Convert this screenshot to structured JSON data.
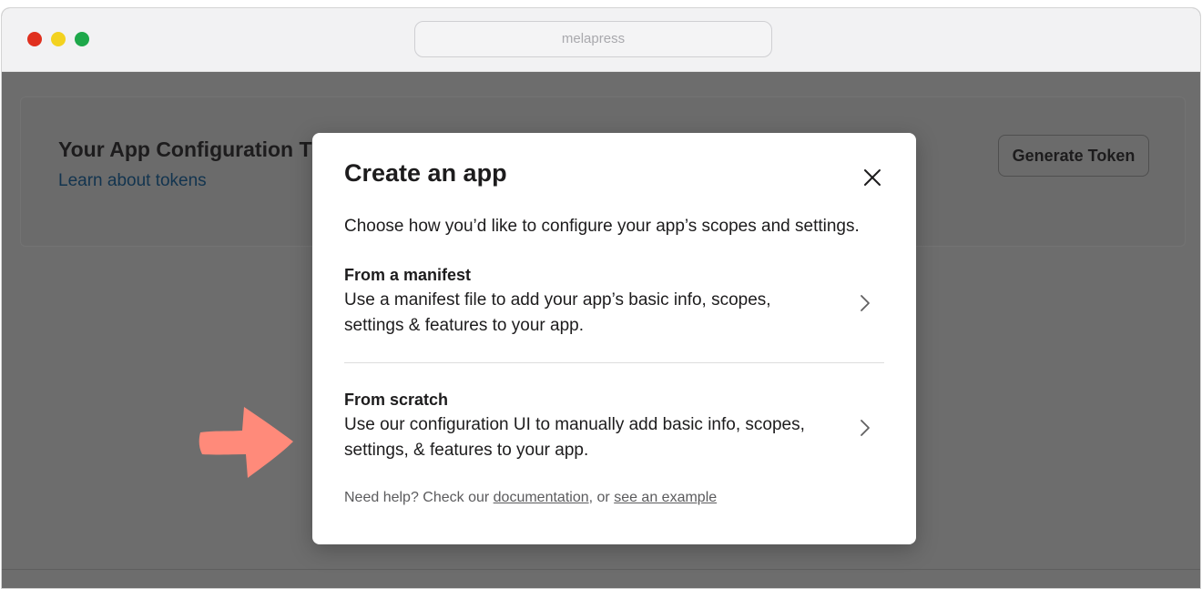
{
  "browser": {
    "url": "melapress"
  },
  "background_card": {
    "title": "Your App Configuration T",
    "link": "Learn about tokens",
    "button": "Generate Token"
  },
  "modal": {
    "title": "Create an app",
    "description": "Choose how you’d like to configure your app’s scopes and settings.",
    "options": [
      {
        "title": "From a manifest",
        "description": "Use a manifest file to add your app’s basic info, scopes, settings & features to your app."
      },
      {
        "title": "From scratch",
        "description": "Use our configuration UI to manually add basic info, scopes, settings, & features to your app."
      }
    ],
    "help": {
      "prefix": "Need help? Check our ",
      "documentation": "documentation",
      "middle": ", or ",
      "example": "see an example"
    }
  },
  "icons": {
    "close": "close-icon",
    "chevron": "chevron-right-icon",
    "pointer": "arrow-right-icon"
  },
  "colors": {
    "overlay": "#6d6d6d",
    "arrow": "#ff8a7a",
    "dot_red": "#e0301e",
    "dot_yellow": "#f3d21f",
    "dot_green": "#1ea84a"
  }
}
